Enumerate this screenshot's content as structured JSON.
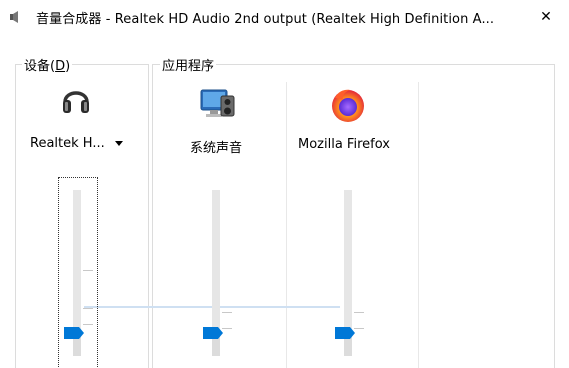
{
  "window": {
    "title": "音量合成器 - Realtek HD Audio 2nd output (Realtek High Definition A...",
    "close_glyph": "✕"
  },
  "device_group": {
    "label": "设备(",
    "accel": "D",
    "label_end": ")",
    "device_name": "Realtek H...",
    "device_icon": "headphones-icon",
    "volume_percent": 14
  },
  "apps_group": {
    "label": "应用程序",
    "apps": [
      {
        "name": "系统声音",
        "icon": "system-sounds-icon",
        "volume_percent": 14
      },
      {
        "name": "Mozilla Firefox",
        "icon": "firefox-icon",
        "volume_percent": 14
      }
    ]
  },
  "colors": {
    "accent": "#0078d7",
    "track": "#e6e6e6",
    "group_line": "#dcdcdc"
  }
}
